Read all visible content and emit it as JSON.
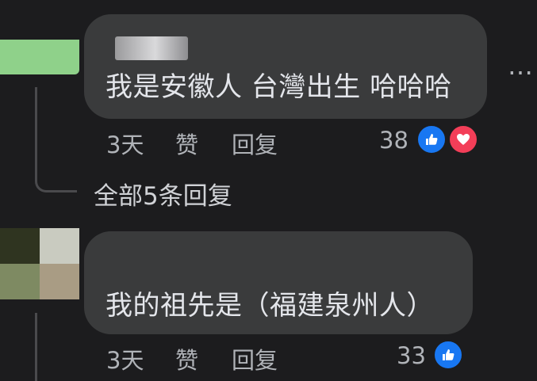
{
  "comments": [
    {
      "text": "我是安徽人 台灣出生 哈哈哈",
      "time": "3天",
      "like_label": "赞",
      "reply_label": "回复",
      "reaction_count": "38",
      "reactions": [
        "like-icon",
        "love-icon"
      ]
    },
    {
      "text": "我的祖先是（福建泉州人）",
      "time": "3天",
      "like_label": "赞",
      "reply_label": "回复",
      "reaction_count": "33",
      "reactions": [
        "like-icon"
      ]
    }
  ],
  "thread": {
    "view_replies_label": "全部5条回复"
  },
  "more_label": "…",
  "colors": {
    "background": "#1c1c1e",
    "bubble": "#3a3b3c",
    "text": "#e4e6eb",
    "meta": "#b0b3b8",
    "like_blue": "#1877f2",
    "love_red": "#f33e58"
  }
}
